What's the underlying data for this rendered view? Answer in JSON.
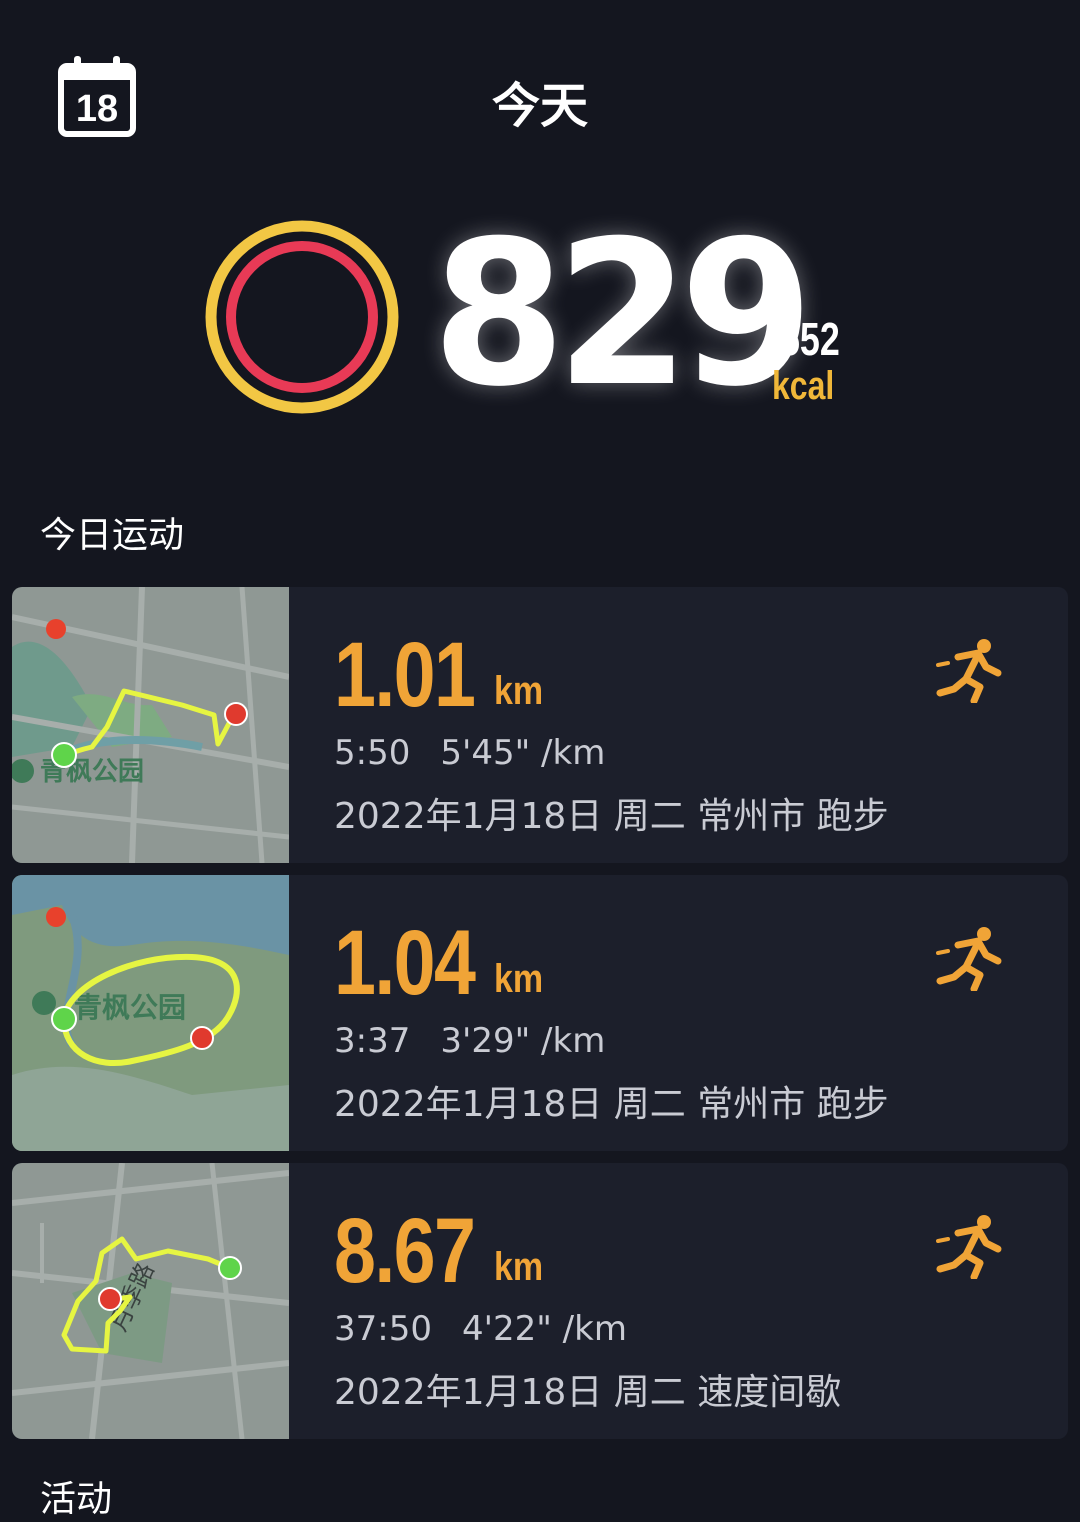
{
  "header": {
    "calendar_day": "18",
    "title": "今天"
  },
  "calories": {
    "value": "829",
    "goal": "/552",
    "unit": "kcal",
    "ring_outer_color": "#f2c744",
    "ring_inner_color": "#e83a56"
  },
  "sections": {
    "today_workouts": "今日运动",
    "activities": "活动"
  },
  "workouts": [
    {
      "distance": "1.01",
      "unit": "km",
      "duration": "5:50",
      "pace": "5'45\" /km",
      "meta": "2022年1月18日 周二 常州市 跑步",
      "map_label": "青枫公园",
      "icon": "running-person-icon"
    },
    {
      "distance": "1.04",
      "unit": "km",
      "duration": "3:37",
      "pace": "3'29\" /km",
      "meta": "2022年1月18日 周二 常州市 跑步",
      "map_label": "青枫公园",
      "icon": "running-person-icon"
    },
    {
      "distance": "8.67",
      "unit": "km",
      "duration": "37:50",
      "pace": "4'22\" /km",
      "meta": "2022年1月18日 周二 速度间歇",
      "map_label": "月季路",
      "icon": "running-person-icon"
    }
  ],
  "colors": {
    "background": "#14161f",
    "card": "#1c1f2b",
    "accent_orange": "#f0a437",
    "route_line": "#e6f542",
    "start_marker": "#5fd44a",
    "end_marker": "#e03a2e"
  }
}
